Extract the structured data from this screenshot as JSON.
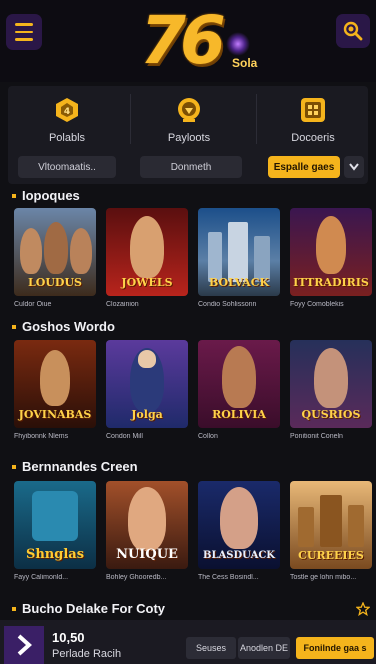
{
  "header": {
    "logo_number": "76",
    "logo_sub": "Sola"
  },
  "quick_menu": {
    "items": [
      {
        "label": "Polabls",
        "icon": "trophy-icon"
      },
      {
        "label": "Payloots",
        "icon": "shield-icon"
      },
      {
        "label": "Docoeris",
        "icon": "calendar-icon"
      }
    ],
    "chips": [
      "Vltoomaatis..",
      "Donmeth",
      "Espalle gaes"
    ]
  },
  "sections": [
    {
      "title": "Iopoques",
      "games": [
        {
          "art": "LOUDUS",
          "caption": "Culdor Oiue"
        },
        {
          "art": "JOWELS",
          "caption": "Clozainion"
        },
        {
          "art": "BOLVACK",
          "caption": "Condio Sohlissonn"
        },
        {
          "art": "ITTRADIRIS",
          "caption": "Foyy Comoblekis"
        }
      ]
    },
    {
      "title": "Goshos Wordo",
      "games": [
        {
          "art": "JOVINABAS",
          "caption": "Fhyibonnk Nlems"
        },
        {
          "art": "Jolga",
          "caption": "Condon Mill"
        },
        {
          "art": "ROLIVIA",
          "caption": "Collon"
        },
        {
          "art": "QUSRIOS",
          "caption": "Ponitionit Coneln"
        }
      ]
    },
    {
      "title": "Bernnandes Creen",
      "games": [
        {
          "art": "Shnglas",
          "caption": "Fayy Calimonld..."
        },
        {
          "art": "NUIQUE",
          "caption": "Bohley Ghooredb..."
        },
        {
          "art": "BLASDUACK",
          "caption": "The Cess Bosindl..."
        },
        {
          "art": "CUREEIES",
          "caption": "Tostle ge lohn mibo..."
        }
      ]
    },
    {
      "title": "Bucho Delake For Coty",
      "games": []
    }
  ],
  "bottom_bar": {
    "amount": "10,50",
    "label": "Perlade Racih",
    "buttons": [
      "Seuses",
      "Anodlen DE",
      "Fonilnde gaa s"
    ]
  },
  "colors": {
    "accent": "#f5b41c",
    "purple": "#3a1f66",
    "bg": "#101014"
  }
}
